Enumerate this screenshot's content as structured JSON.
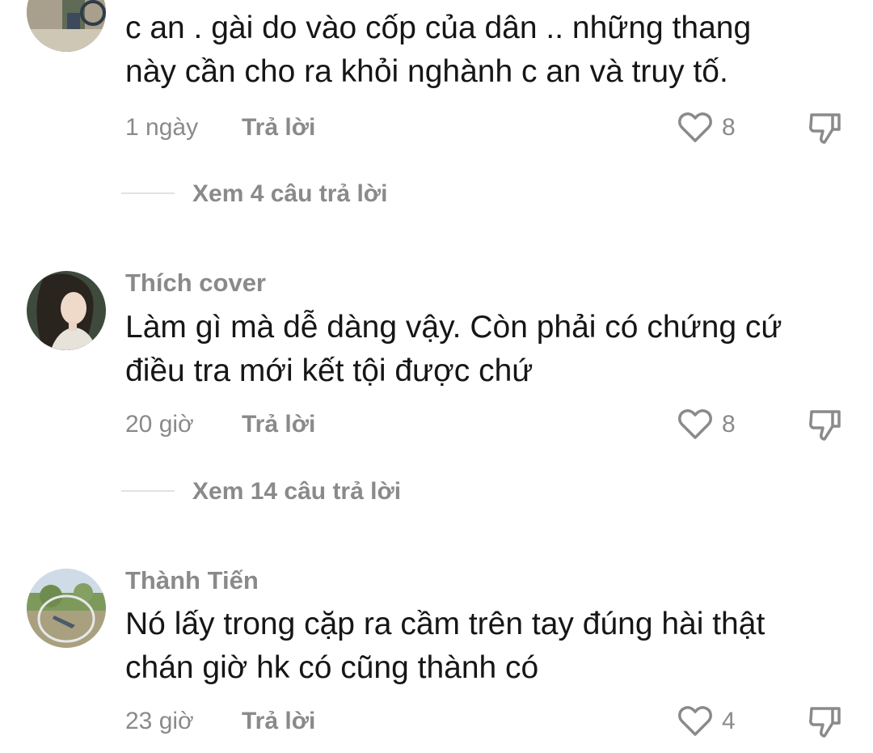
{
  "comments": [
    {
      "username": "",
      "text_lines": [
        "c an . gài do vào cốp của dân .. những thang",
        "này cần cho ra khỏi nghành c an và truy tố."
      ],
      "time": "1 ngày",
      "reply_label": "Trả lời",
      "likes": "8",
      "view_replies": "Xem 4 câu trả lời"
    },
    {
      "username": "Thích cover",
      "text_lines": [
        "Làm gì mà dễ dàng vậy. Còn phải có chứng cứ",
        "điều tra mới kết tội được chứ"
      ],
      "time": "20 giờ",
      "reply_label": "Trả lời",
      "likes": "8",
      "view_replies": "Xem 14 câu trả lời"
    },
    {
      "username": "Thành Tiến",
      "text_lines": [
        "Nó lấy trong cặp ra cầm trên tay đúng hài thật",
        "chán giờ hk có cũng thành có"
      ],
      "time": "23 giờ",
      "reply_label": "Trả lời",
      "likes": "4"
    }
  ],
  "icons": {
    "like": "heart-outline-icon",
    "dislike": "thumbs-down-outline-icon"
  },
  "colors": {
    "text": "#161616",
    "muted": "#8a8a8a",
    "divider": "#e2e2e2"
  }
}
